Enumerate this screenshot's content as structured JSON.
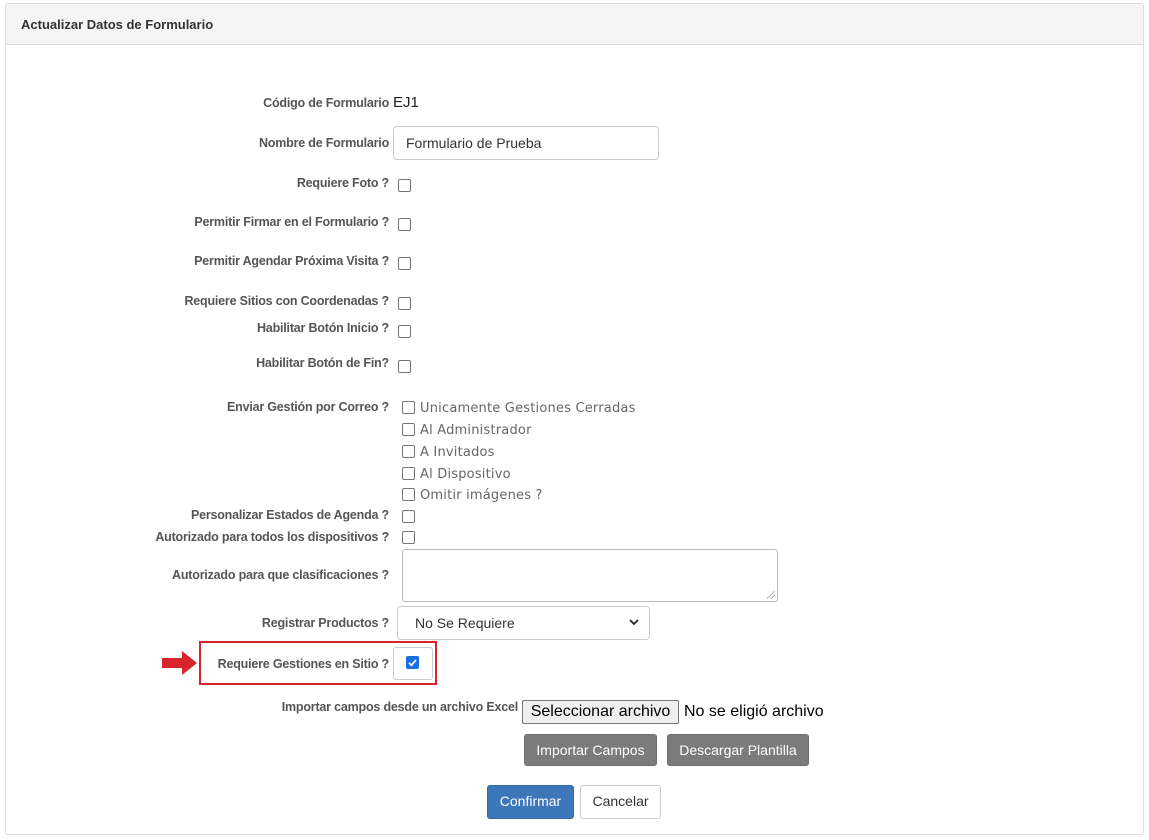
{
  "panel": {
    "title": "Actualizar Datos de Formulario"
  },
  "form": {
    "codigo_label": "Código de Formulario",
    "codigo_value": "EJ1",
    "nombre_label": "Nombre de Formulario",
    "nombre_value": "Formulario de Prueba",
    "requiere_foto_label": "Requiere Foto ?",
    "permitir_firmar_label": "Permitir Firmar en el Formulario ?",
    "permitir_agendar_label": "Permitir Agendar Próxima Visita ?",
    "requiere_sitios_label": "Requiere Sitios con Coordenadas ?",
    "habilitar_inicio_label": "Habilitar Botón Inicio ?",
    "habilitar_fin_label": "Habilitar Botón de Fin?",
    "enviar_correo_label": "Enviar Gestión por Correo ?",
    "enviar_correo_options": [
      "Unicamente Gestiones Cerradas",
      "Al Administrador",
      "A Invitados",
      "Al Dispositivo",
      "Omitir imágenes ?"
    ],
    "personalizar_estados_label": "Personalizar Estados de Agenda ?",
    "autorizado_dispositivos_label": "Autorizado para todos los dispositivos ?",
    "autorizado_clasificaciones_label": "Autorizado para que clasificaciones ?",
    "registrar_productos_label": "Registrar Productos ?",
    "registrar_productos_value": "No Se Requiere",
    "requiere_gestiones_label": "Requiere Gestiones en Sitio ?",
    "requiere_gestiones_checked": true,
    "importar_label": "Importar campos desde un archivo Excel",
    "file_button_label": "Seleccionar archivo",
    "file_status": "No se eligió archivo",
    "importar_campos_button": "Importar Campos",
    "descargar_plantilla_button": "Descargar Plantilla",
    "confirmar_button": "Confirmar",
    "cancelar_button": "Cancelar"
  },
  "colors": {
    "highlight": "#d9242b",
    "primary": "#3c77b9",
    "gray_button": "#7b7b7b"
  }
}
